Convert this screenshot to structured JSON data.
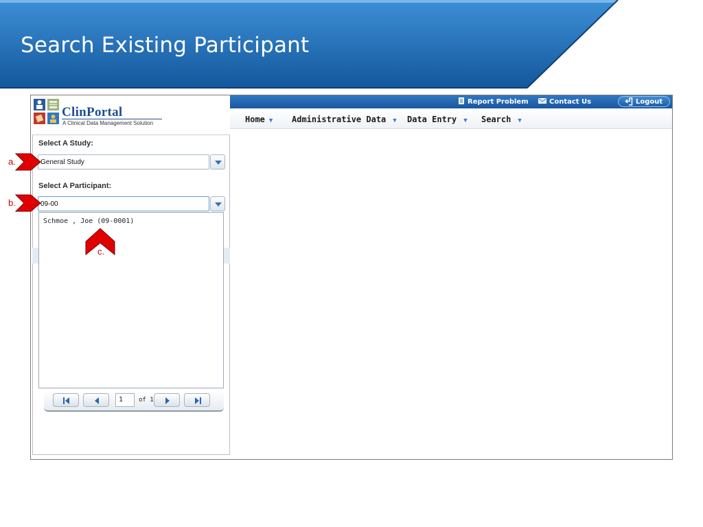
{
  "slide": {
    "title": "Search Existing Participant"
  },
  "app": {
    "logo": {
      "title_main": "Clin",
      "title_rest": "Portal",
      "subtitle": "A Clinical Data Management Solution"
    },
    "topbar": {
      "report_problem": "Report Problem",
      "contact_us": "Contact Us",
      "logout": "Logout"
    },
    "nav": [
      {
        "label": "Home"
      },
      {
        "label": "Administrative Data"
      },
      {
        "label": "Data Entry"
      },
      {
        "label": "Search"
      }
    ],
    "study": {
      "label": "Select A Study:",
      "value": "General Study"
    },
    "participant": {
      "label": "Select A Participant:",
      "value": "09-00",
      "options": [
        "Schmoe , Joe (09-0001)"
      ]
    },
    "pager": {
      "page": "1",
      "of_text": "of 1"
    }
  },
  "annotations": {
    "a": "a.",
    "b": "b.",
    "c": "c."
  },
  "colors": {
    "banner": "#1f6fb5",
    "accent": "#3b7dd0",
    "annotation": "#e00000"
  }
}
